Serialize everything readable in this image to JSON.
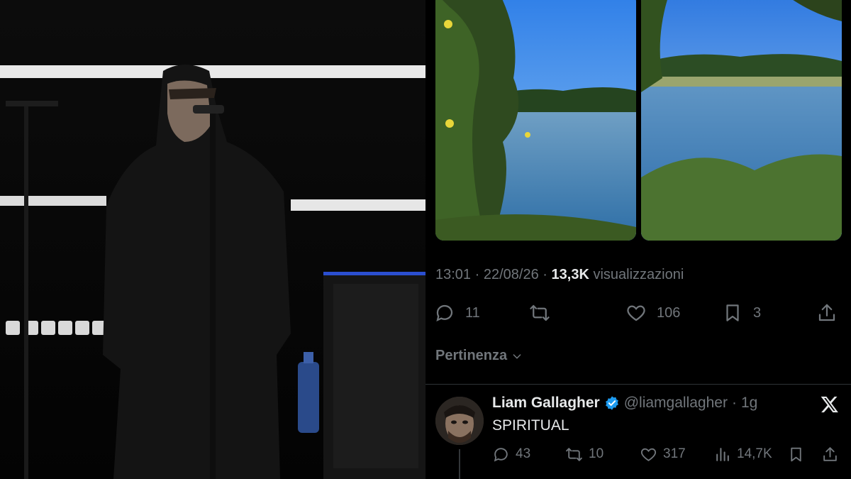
{
  "tweet": {
    "time": "13:01",
    "date": "22/08/26",
    "views_count": "13,3K",
    "views_label": "visualizzazioni",
    "separator": "·"
  },
  "actions": {
    "replies": "11",
    "likes": "106",
    "bookmarks": "3"
  },
  "sort": {
    "label": "Pertinenza"
  },
  "reply": {
    "name": "Liam Gallagher",
    "handle": "@liamgallagher",
    "age": "1g",
    "separator": "·",
    "text": "SPIRITUAL",
    "stats": {
      "replies": "43",
      "reposts": "10",
      "likes": "317",
      "views": "14,7K"
    }
  },
  "icons": {
    "reply": "speech-bubble-icon",
    "repost": "repost-arrows-icon",
    "like": "heart-icon",
    "bookmark": "bookmark-icon",
    "share": "share-upload-icon",
    "views": "bar-chart-icon",
    "verified": "verified-badge-icon",
    "brand": "x-logo-icon",
    "sort": "chevron-down-icon"
  },
  "colors": {
    "background": "#000000",
    "text": "#e7e9ea",
    "muted": "#71767b",
    "verified": "#1d9bf0",
    "divider": "#2f3336"
  }
}
